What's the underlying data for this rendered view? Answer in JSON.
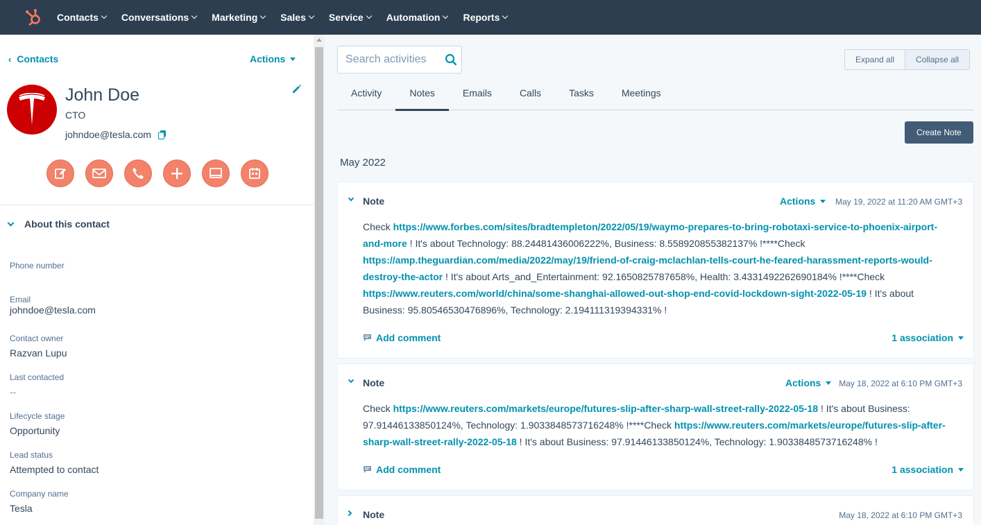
{
  "nav": {
    "items": [
      "Contacts",
      "Conversations",
      "Marketing",
      "Sales",
      "Service",
      "Automation",
      "Reports"
    ]
  },
  "contact": {
    "back_label": "Contacts",
    "actions_label": "Actions",
    "name": "John Doe",
    "title": "CTO",
    "email": "johndoe@tesla.com",
    "about_label": "About this contact",
    "properties": [
      {
        "label": "Phone number",
        "value": ""
      },
      {
        "label": "Email",
        "value": "johndoe@tesla.com"
      },
      {
        "label": "Contact owner",
        "value": "Razvan Lupu"
      },
      {
        "label": "Last contacted",
        "value": "--"
      },
      {
        "label": "Lifecycle stage",
        "value": "Opportunity"
      },
      {
        "label": "Lead status",
        "value": "Attempted to contact"
      },
      {
        "label": "Company name",
        "value": "Tesla"
      }
    ]
  },
  "activities": {
    "search_placeholder": "Search activities",
    "expand_all": "Expand all",
    "collapse_all": "Collapse all",
    "tabs": [
      "Activity",
      "Notes",
      "Emails",
      "Calls",
      "Tasks",
      "Meetings"
    ],
    "active_tab": "Notes",
    "create_note_label": "Create Note",
    "month": "May 2022",
    "notes": [
      {
        "title": "Note",
        "actions_label": "Actions",
        "date": "May 19, 2022 at 11:20 AM GMT+3",
        "segments": [
          {
            "t": "Check "
          },
          {
            "t": "https://www.forbes.com/sites/bradtempleton/2022/05/19/waymo-prepares-to-bring-robotaxi-service-to-phoenix-airport-and-more",
            "link": true
          },
          {
            "t": " ! It's about Technology: 88.24481436006222%, Business: 8.558920855382137% !****Check "
          },
          {
            "t": "https://amp.theguardian.com/media/2022/may/19/friend-of-craig-mclachlan-tells-court-he-feared-harassment-reports-would-destroy-the-actor",
            "link": true
          },
          {
            "t": " ! It's about Arts_and_Entertainment: 92.1650825787658%, Health: 3.4331492262690184% !****Check "
          },
          {
            "t": "https://www.reuters.com/world/china/some-shanghai-allowed-out-shop-end-covid-lockdown-sight-2022-05-19",
            "link": true
          },
          {
            "t": " ! It's about Business: 95.80546530476896%, Technology: 2.194111319394331% !"
          }
        ],
        "comment_label": "Add comment",
        "association_label": "1 association"
      },
      {
        "title": "Note",
        "actions_label": "Actions",
        "date": "May 18, 2022 at 6:10 PM GMT+3",
        "segments": [
          {
            "t": "Check "
          },
          {
            "t": "https://www.reuters.com/markets/europe/futures-slip-after-sharp-wall-street-rally-2022-05-18",
            "link": true
          },
          {
            "t": " ! It's about Business: 97.91446133850124%, Technology: 1.9033848573716248% !****Check "
          },
          {
            "t": "https://www.reuters.com/markets/europe/futures-slip-after-sharp-wall-street-rally-2022-05-18",
            "link": true
          },
          {
            "t": " ! It's about Business: 97.91446133850124%, Technology: 1.9033848573716248% !"
          }
        ],
        "comment_label": "Add comment",
        "association_label": "1 association"
      },
      {
        "title": "Note",
        "date": "May 18, 2022 at 6:10 PM GMT+3"
      }
    ]
  },
  "colors": {
    "nav_bg": "#2d3e50",
    "link": "#0091ae",
    "action_button": "#f2826a",
    "avatar_bg": "#cc0000",
    "create_note_bg": "#425b76"
  }
}
